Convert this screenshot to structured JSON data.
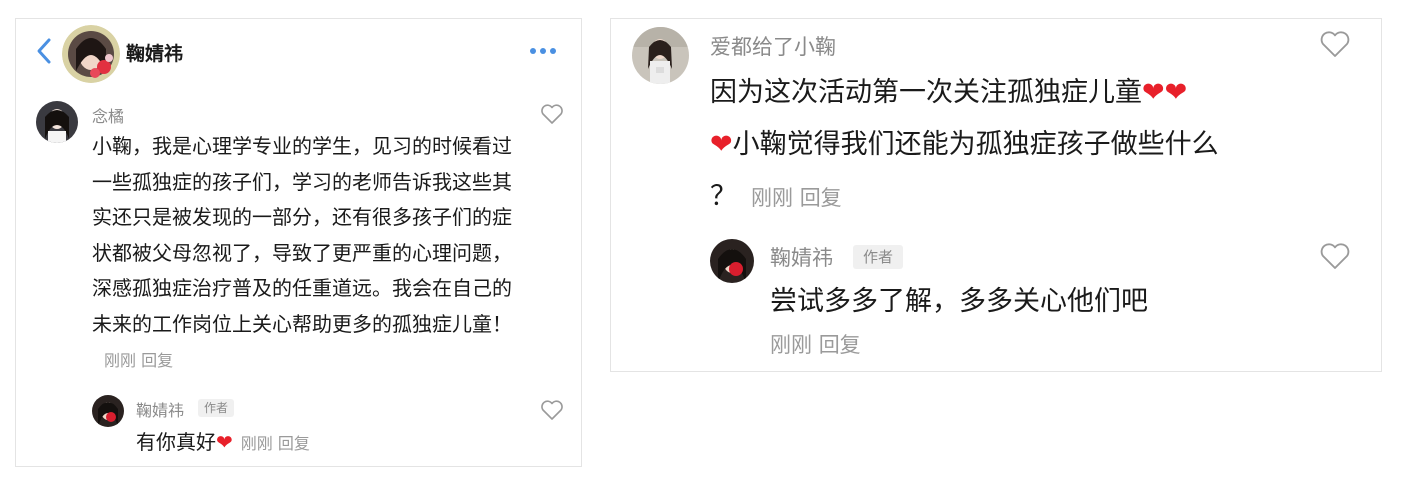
{
  "header": {
    "title": "鞠婧祎"
  },
  "comment_left": {
    "author": "念橘",
    "text": "小鞠，我是心理学专业的学生，见习的时候看过一些孤独症的孩子们，学习的老师告诉我这些其实还只是被发现的一部分，还有很多孩子们的症状都被父母忽视了，导致了更严重的心理问题，深感孤独症治疗普及的任重道远。我会在自己的未来的工作岗位上关心帮助更多的孤独症儿童！",
    "time": "刚刚",
    "reply_label": "回复"
  },
  "reply_left": {
    "author": "鞠婧祎",
    "author_tag": "作者",
    "text": "有你真好",
    "emoji": "❤",
    "time": "刚刚",
    "reply_label": "回复"
  },
  "comment_right": {
    "author": "爱都给了小鞠",
    "text_line1": "因为这次活动第一次关注孤独症儿童",
    "text_line2": "小鞠觉得我们还能为孤独症孩子做些什么",
    "text_line3": "？",
    "emoji": "❤",
    "time": "刚刚",
    "reply_label": "回复"
  },
  "reply_right": {
    "author": "鞠婧祎",
    "author_tag": "作者",
    "text": "尝试多多了解，多多关心他们吧",
    "time": "刚刚",
    "reply_label": "回复"
  },
  "colors": {
    "accent_blue": "#4a90e2",
    "heart_red": "#e8202a",
    "meta_gray": "#9a9a9a",
    "name_gray": "#8a8a8a"
  },
  "icons": {
    "back": "chevron-left-icon",
    "more": "more-dots-icon",
    "like": "heart-outline-icon"
  }
}
